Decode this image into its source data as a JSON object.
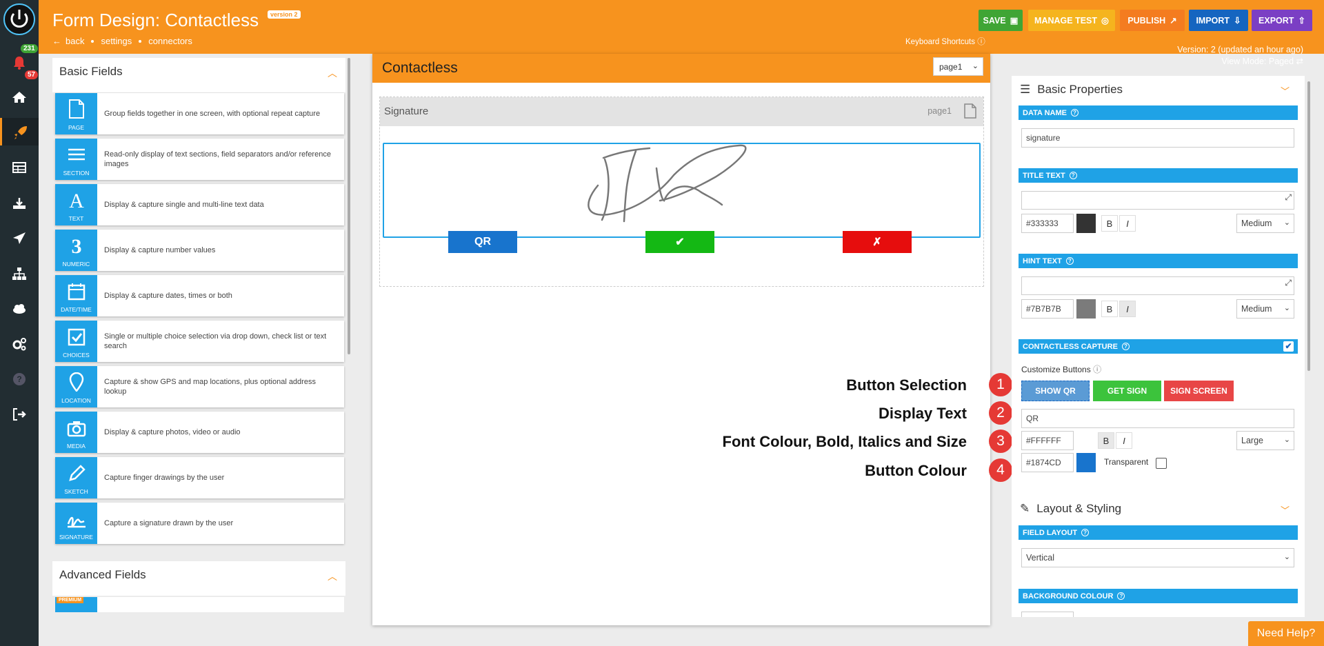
{
  "app": {
    "title": "Form Design: Contactless",
    "version_badge": "version 2",
    "breadcrumbs": [
      "back",
      "settings",
      "connectors"
    ],
    "keyboard_shortcuts": "Keyboard Shortcuts",
    "version_info": "Version: 2 (updated an hour ago)",
    "view_mode": "View Mode: Paged",
    "need_help": "Need Help?"
  },
  "sidebar": {
    "badge_top": "231",
    "badge_notif": "57",
    "icons": [
      "bell-icon",
      "home-icon",
      "rocket-icon",
      "table-icon",
      "download-icon",
      "send-icon",
      "sitemap-icon",
      "cloud-icon",
      "cogs-icon",
      "help-icon",
      "logout-icon"
    ]
  },
  "toolbar": {
    "save": "SAVE",
    "manage_test": "MANAGE TEST",
    "publish": "PUBLISH",
    "import": "IMPORT",
    "export": "EXPORT"
  },
  "colors": {
    "orange": "#f7931e",
    "blue": "#1fa2e6",
    "save": "#3fa535",
    "manage_test": "#f5b41e",
    "publish": "#f47c20",
    "import": "#1565c0",
    "export": "#7b3fc4"
  },
  "basic_fields": {
    "title": "Basic Fields",
    "items": [
      {
        "tile": "PAGE",
        "desc": "Group fields together in one screen, with optional repeat capture"
      },
      {
        "tile": "SECTION",
        "desc": "Read-only display of text sections, field separators and/or reference images"
      },
      {
        "tile": "TEXT",
        "desc": "Display & capture single and multi-line text data"
      },
      {
        "tile": "NUMERIC",
        "desc": "Display & capture number values"
      },
      {
        "tile": "DATE/TIME",
        "desc": "Display & capture dates, times or both"
      },
      {
        "tile": "CHOICES",
        "desc": "Single or multiple choice selection via drop down, check list or text search"
      },
      {
        "tile": "LOCATION",
        "desc": "Capture & show GPS and map locations, plus optional address lookup"
      },
      {
        "tile": "MEDIA",
        "desc": "Display & capture photos, video or audio"
      },
      {
        "tile": "SKETCH",
        "desc": "Capture finger drawings by the user"
      },
      {
        "tile": "SIGNATURE",
        "desc": "Capture a signature drawn by the user"
      }
    ]
  },
  "advanced_fields": {
    "title": "Advanced Fields",
    "premium": "PREMIUM"
  },
  "canvas": {
    "title": "Contactless",
    "page_select": "page1",
    "field_title": "Signature",
    "field_page": "page1",
    "btn_qr": "QR",
    "btn_ok": "✔",
    "btn_cancel": "✗"
  },
  "annotations": {
    "n1": "1",
    "t1": "Button Selection",
    "n2": "2",
    "t2": "Display Text",
    "n3": "3",
    "t3": "Font Colour, Bold, Italics and Size",
    "n4": "4",
    "t4": "Button Colour"
  },
  "properties": {
    "section_title": "Basic Properties",
    "data_name_label": "DATA NAME",
    "data_name_value": "signature",
    "title_text_label": "TITLE TEXT",
    "title_color": "#333333",
    "title_size": "Medium",
    "hint_text_label": "HINT TEXT",
    "hint_color": "#7B7B7B",
    "hint_size": "Medium",
    "contactless_label": "CONTACTLESS CAPTURE",
    "customize_buttons": "Customize Buttons",
    "btn_show_qr": "SHOW QR",
    "btn_get_sign": "GET SIGN",
    "btn_sign_screen": "SIGN SCREEN",
    "display_text": "QR",
    "font_color": "#FFFFFF",
    "font_size": "Large",
    "button_color": "#1874CD",
    "transparent_label": "Transparent",
    "bold": "B",
    "italic": "I",
    "layout_title": "Layout & Styling",
    "field_layout_label": "FIELD LAYOUT",
    "field_layout_value": "Vertical",
    "background_label": "BACKGROUND COLOUR"
  }
}
